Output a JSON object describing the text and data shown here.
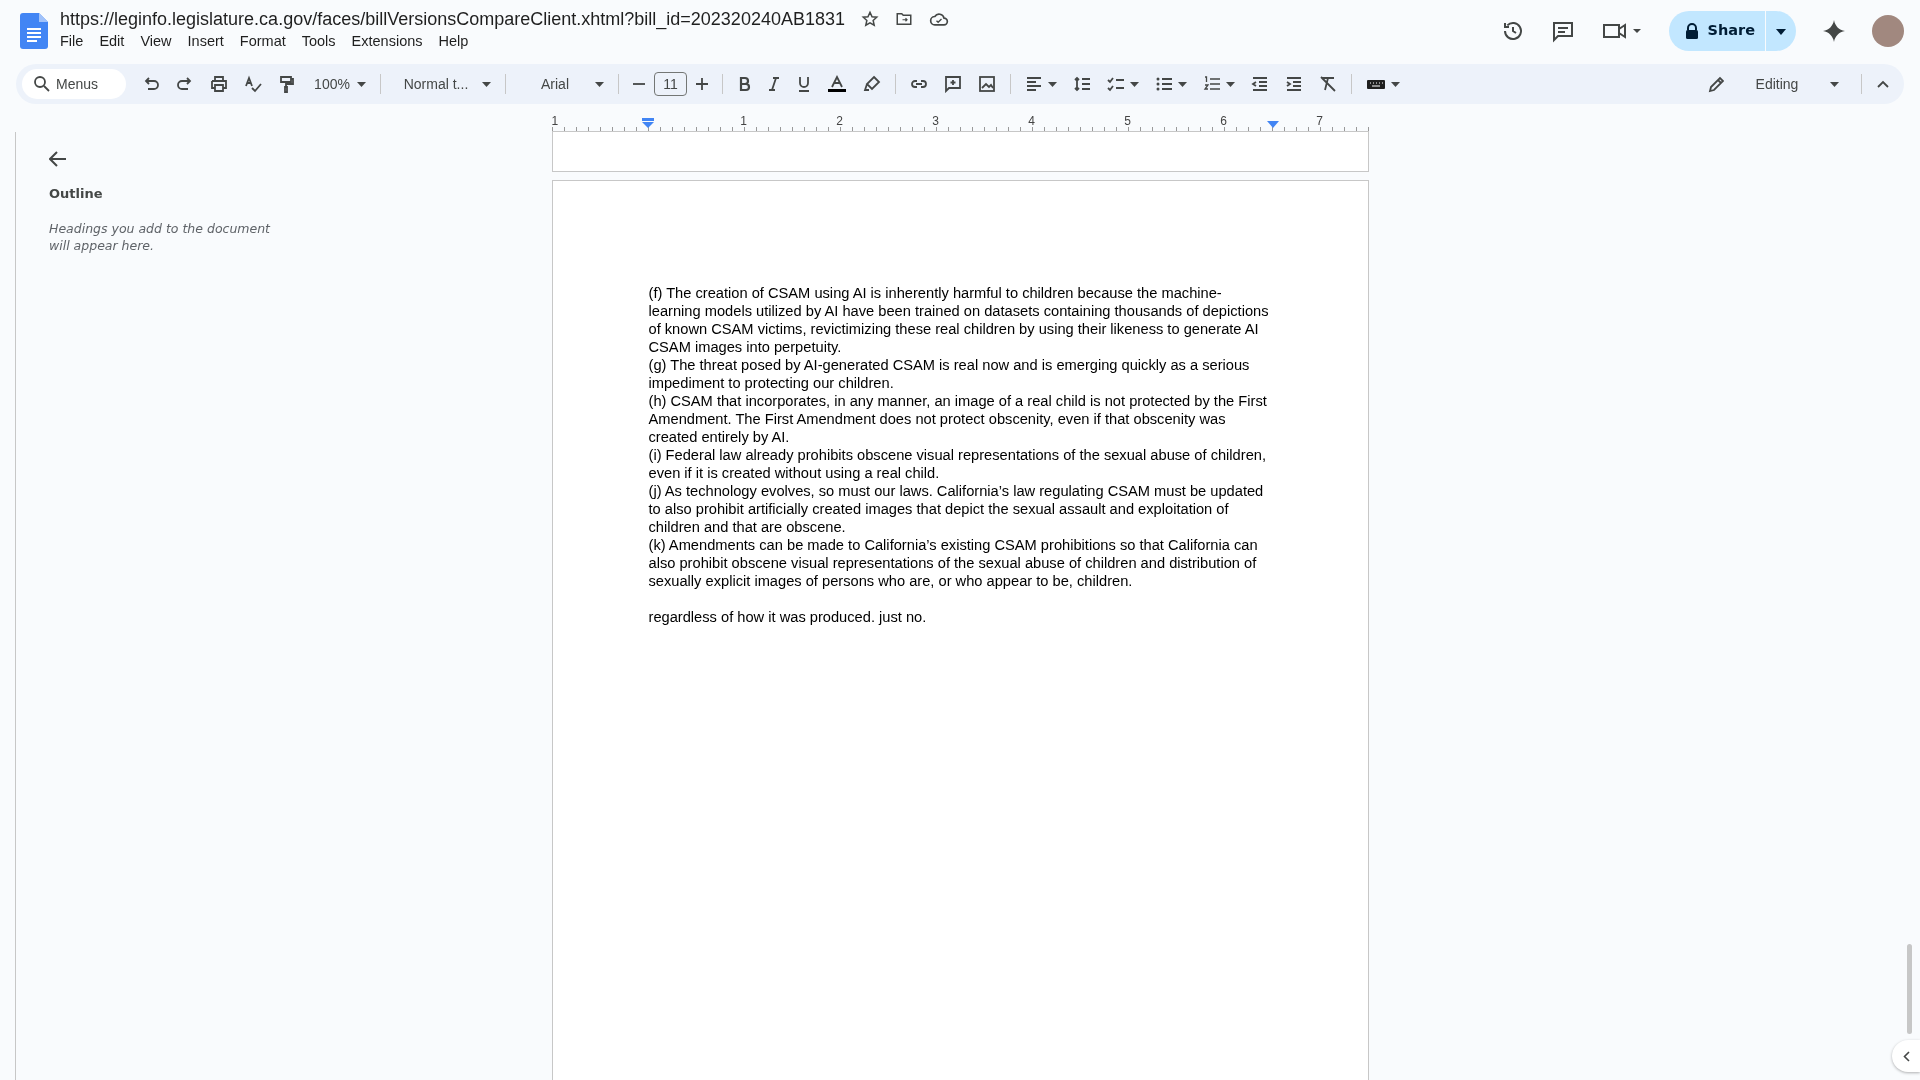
{
  "title": "https://leginfo.legislature.ca.gov/faces/billVersionsCompareClient.xhtml?bill_id=202320240AB1831",
  "menu": [
    "File",
    "Edit",
    "View",
    "Insert",
    "Format",
    "Tools",
    "Extensions",
    "Help"
  ],
  "share": "Share",
  "toolbar": {
    "search_placeholder": "Menus",
    "zoom": "100%",
    "style": "Normal t...",
    "font": "Arial",
    "font_size": "11",
    "mode": "Editing"
  },
  "ruler": [
    "1",
    "1",
    "2",
    "3",
    "4",
    "5",
    "6",
    "7"
  ],
  "sidebar": {
    "title": "Outline",
    "hint": "Headings you add to the document will appear here."
  },
  "paragraphs": [
    "(f) The creation of CSAM using AI is inherently harmful to children because the machine-learning models utilized by AI have been trained on datasets containing thousands of depictions of known CSAM victims, revictimizing these real children by using their likeness to generate AI CSAM images into perpetuity.",
    "(g) The threat posed by AI-generated CSAM is real now and is emerging quickly as a serious impediment to protecting our children.",
    "(h) CSAM that incorporates, in any manner, an image of a real child is not protected by the First Amendment. The First Amendment does not protect obscenity, even if that obscenity was created entirely by AI.",
    "(i) Federal law already prohibits obscene visual representations of the sexual abuse of children, even if it is created without using a real child.",
    "(j) As technology evolves, so must our laws. California’s law regulating CSAM must be updated to also prohibit artificially created images that depict the sexual assault and exploitation of children and that are obscene.",
    "(k) Amendments can be made to California’s existing CSAM prohibitions so that California can also prohibit obscene visual representations of the sexual abuse of children and distribution of sexually explicit images of persons who are, or who appear to be, children."
  ],
  "note": "regardless of how it was produced. just no."
}
